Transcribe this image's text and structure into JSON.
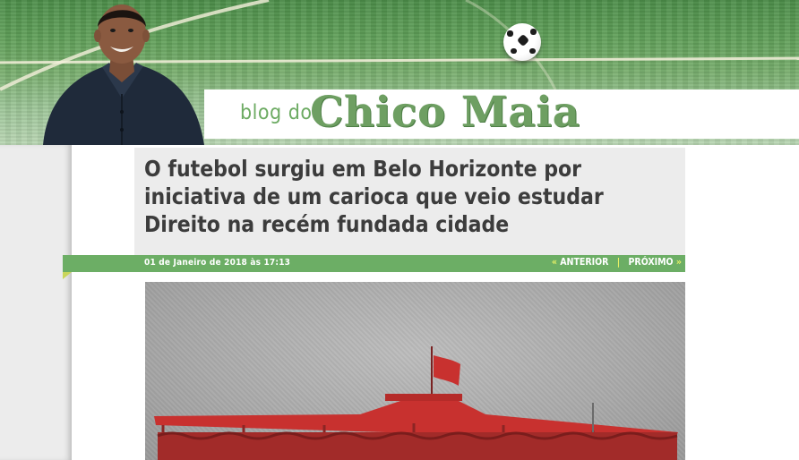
{
  "header": {
    "logo_prefix": "blog do",
    "logo_name": "Chico Maia"
  },
  "post": {
    "title": "O futebol surgiu em Belo Horizonte por iniciativa de um carioca que veio estudar Direito na recém fundada cidade",
    "date": "01 de Janeiro de 2018 às 17:13",
    "nav": {
      "prev_arrow": "«",
      "prev_label": "ANTERIOR",
      "separator": "|",
      "next_label": "PRÓXIMO",
      "next_arrow": "»"
    }
  },
  "icons": [
    "soccer-ball-icon",
    "portrait-photo",
    "stadium-photo"
  ],
  "colors": {
    "brand_green": "#6cae65",
    "accent_yellow": "#e7f066",
    "title_text": "#3c3c3c",
    "title_bg": "#ececec"
  }
}
